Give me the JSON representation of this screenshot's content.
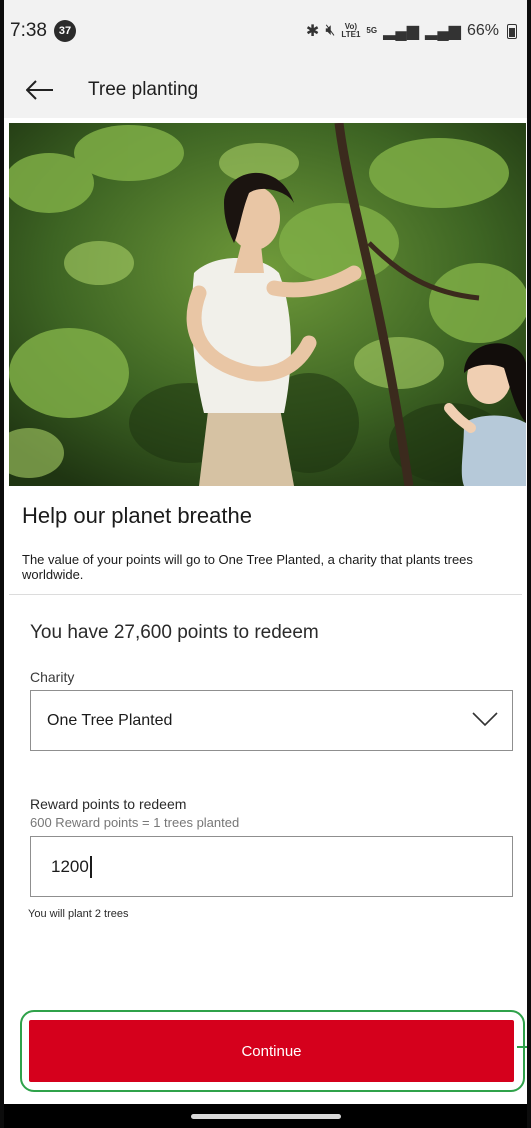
{
  "status_bar": {
    "time": "7:38",
    "notification_count": "37",
    "volte": "Vo)",
    "lte": "LTE1",
    "net_5g": "5G",
    "battery": "66%"
  },
  "app_bar": {
    "title": "Tree planting"
  },
  "content": {
    "headline": "Help our planet breathe",
    "intro": "The value of your points will go to One Tree Planted, a charity that plants trees worldwide.",
    "points_line": "You have 27,600 points to redeem"
  },
  "form": {
    "charity_label": "Charity",
    "charity_value": "One Tree Planted",
    "redeem_label": "Reward points to redeem",
    "rate_text": "600 Reward points = 1 trees planted",
    "amount_value": "1200",
    "result_text": "You will plant 2 trees",
    "continue_label": "Continue"
  },
  "colors": {
    "accent_red": "#d5001c",
    "highlight_green": "#2fa24a"
  },
  "icons": {
    "back": "arrow-left-icon",
    "dropdown": "chevron-down-icon"
  }
}
